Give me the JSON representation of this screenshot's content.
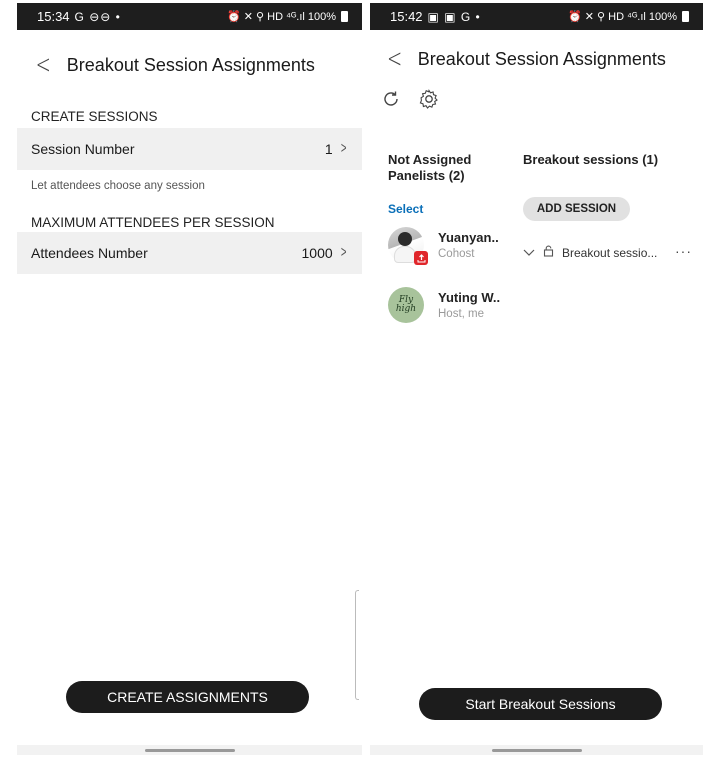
{
  "left_screen": {
    "status_bar": {
      "time": "15:34",
      "left_icons": "G ⊖⊖ •",
      "right_icons": "⏰ ✕ ⚲ HD ⁴ᴳ.ıl",
      "battery": "100%"
    },
    "header": {
      "title": "Breakout Session Assignments"
    },
    "create_sessions": {
      "section_label": "CREATE SESSIONS",
      "row_label": "Session Number",
      "row_value": "1",
      "hint": "Let attendees choose any session"
    },
    "max_attendees": {
      "section_label": "MAXIMUM ATTENDEES PER SESSION",
      "row_label": "Attendees Number",
      "row_value": "1000"
    },
    "primary_button": "CREATE ASSIGNMENTS"
  },
  "right_screen": {
    "status_bar": {
      "time": "15:42",
      "left_icons": "▣ ▣ G •",
      "right_icons": "⏰ ✕ ⚲ HD ⁴ᴳ.ıl",
      "battery": "100%"
    },
    "header": {
      "title": "Breakout Session Assignments"
    },
    "toolbar": {
      "icons": [
        "refresh-icon",
        "gear-icon"
      ]
    },
    "not_assigned_heading": "Not Assigned Panelists (2)",
    "breakout_heading": "Breakout sessions (1)",
    "select_label": "Select",
    "add_session_label": "ADD SESSION",
    "panelists": [
      {
        "name": "Yuanyan..",
        "role": "Cohost"
      },
      {
        "name": "Yuting W..",
        "role": "Host, me",
        "avatar_text": "Fly high"
      }
    ],
    "session": {
      "name": "Breakout sessio...",
      "more": "···"
    },
    "primary_button": "Start Breakout Sessions"
  },
  "colors": {
    "button_bg": "#1c1c1c",
    "link": "#0a6fb8",
    "status_bar": "#1e1e1e",
    "badge": "#e0262b"
  }
}
